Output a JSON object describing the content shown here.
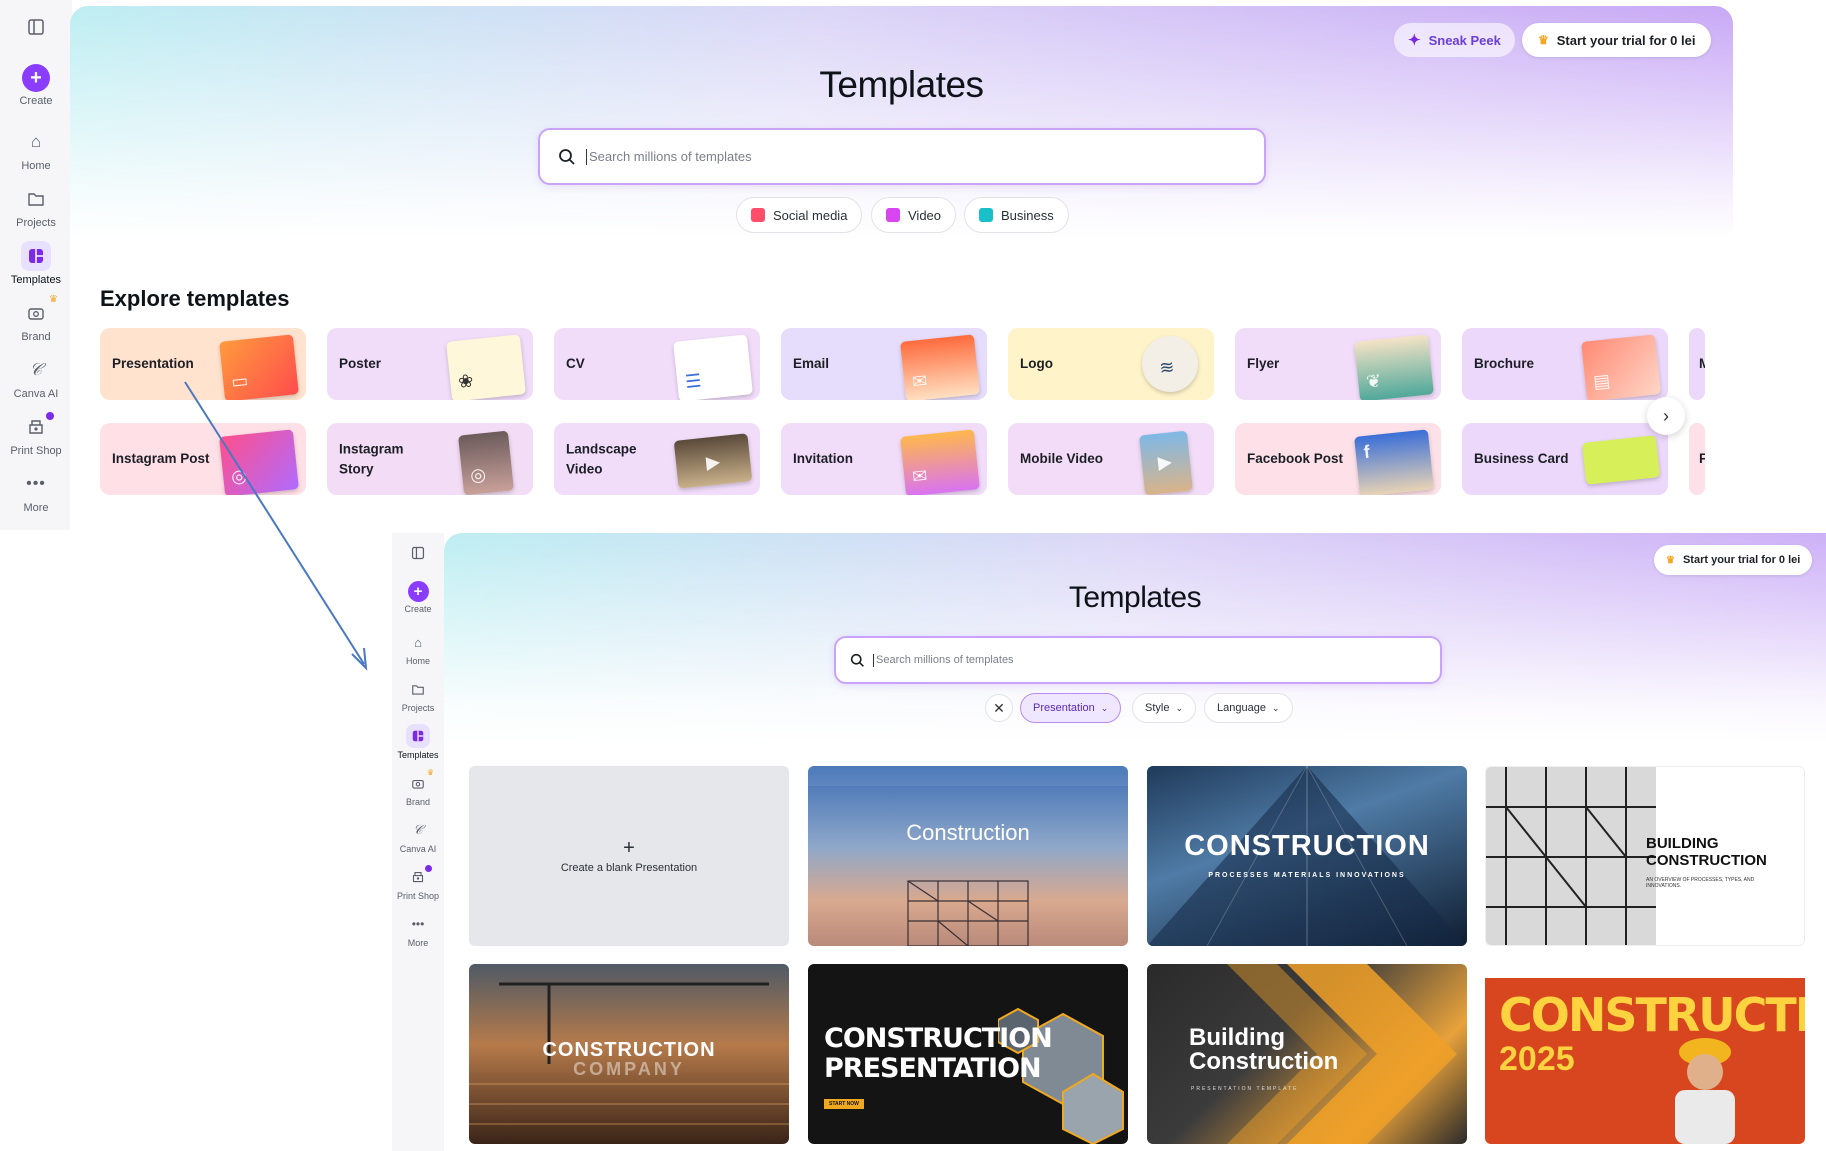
{
  "sidebar": {
    "toggle_icon": "sidebar-toggle-icon",
    "items": [
      {
        "label": "Create",
        "icon": "plus-icon"
      },
      {
        "label": "Home",
        "icon": "home-icon"
      },
      {
        "label": "Projects",
        "icon": "folder-icon"
      },
      {
        "label": "Templates",
        "icon": "templates-icon"
      },
      {
        "label": "Brand",
        "icon": "brand-icon"
      },
      {
        "label": "Canva AI",
        "icon": "canva-ai-icon"
      },
      {
        "label": "Print Shop",
        "icon": "print-shop-icon"
      },
      {
        "label": "More",
        "icon": "more-icon"
      }
    ]
  },
  "panel1": {
    "sneak_peek": "Sneak Peek",
    "trial_button": "Start your trial for 0 lei",
    "title": "Templates",
    "search_placeholder": "Search millions of templates",
    "chips": [
      "Social media",
      "Video",
      "Business"
    ],
    "section_title": "Explore templates",
    "row1": [
      "Presentation",
      "Poster",
      "CV",
      "Email",
      "Logo",
      "Flyer",
      "Brochure",
      "M"
    ],
    "row2": [
      "Instagram Post",
      "Instagram Story",
      "Landscape Video",
      "Invitation",
      "Mobile Video",
      "Facebook Post",
      "Business Card",
      "F"
    ]
  },
  "panel2": {
    "trial_button": "Start your trial for 0 lei",
    "title": "Templates",
    "search_placeholder": "Search millions of templates",
    "filters": [
      "Presentation",
      "Style",
      "Language"
    ],
    "blank_card": "Create a blank Presentation",
    "templates": [
      {
        "title": "Construction",
        "sub": ""
      },
      {
        "title": "CONSTRUCTION",
        "sub": "PROCESSES  MATERIALS  INNOVATIONS"
      },
      {
        "title": "BUILDING CONSTRUCTION",
        "sub": "AN OVERVIEW OF PROCESSES, TYPES, AND INNOVATIONS."
      },
      {
        "title": "CONSTRUCTION",
        "sub": "COMPANY"
      },
      {
        "title": "CONSTRUCTION PRESENTATION",
        "sub": "START NOW"
      },
      {
        "title": "Building Construction",
        "sub": "PRESENTATION TEMPLATE"
      },
      {
        "title": "CONSTRUCTION",
        "sub": "2025"
      }
    ]
  },
  "colors": {
    "accent": "#8b3dff",
    "arrow": "#4a78c2"
  }
}
